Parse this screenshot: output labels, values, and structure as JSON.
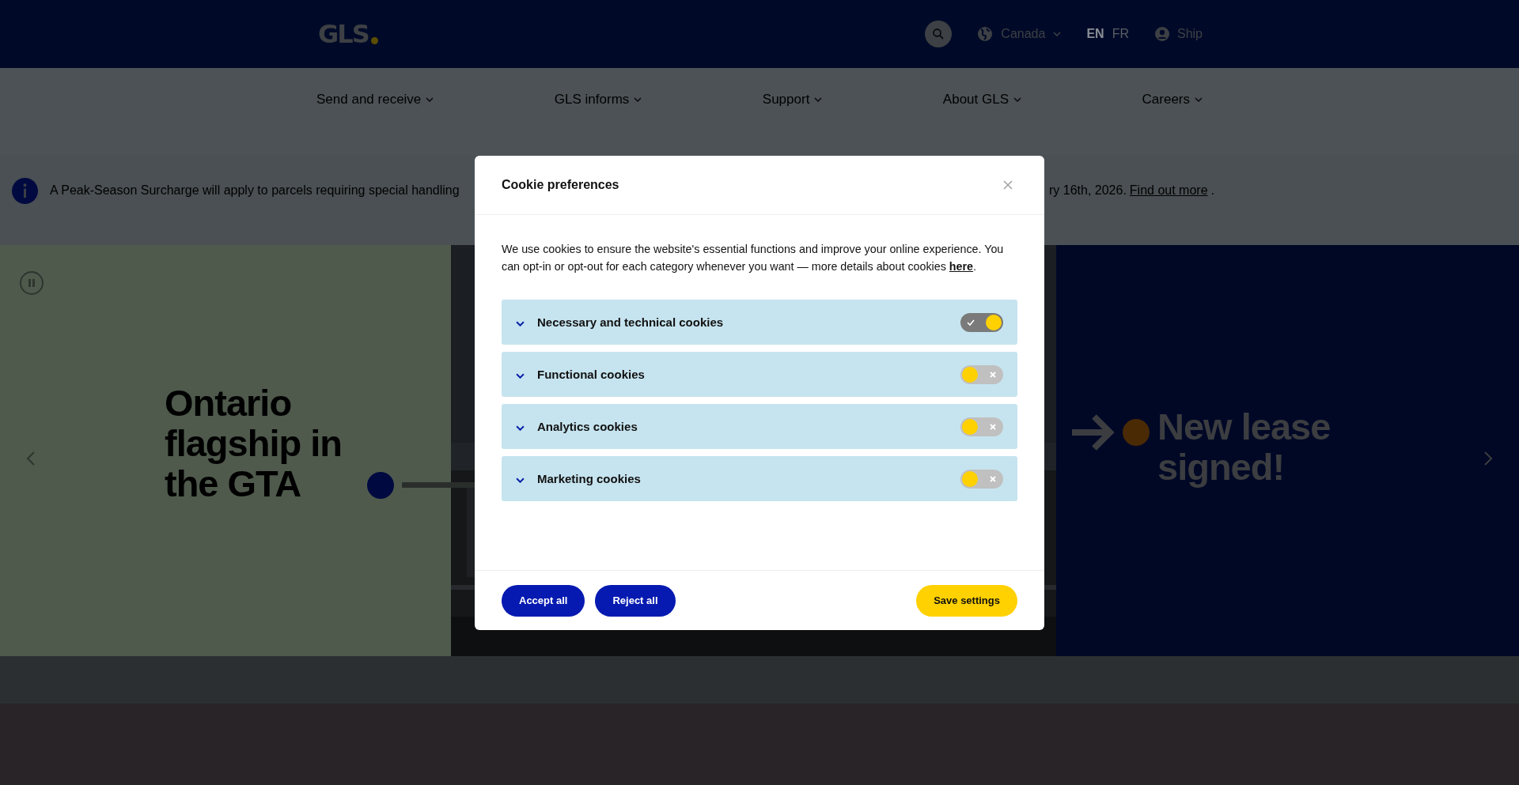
{
  "header": {
    "logo": "GLS",
    "country": "Canada",
    "account": "Ship",
    "languages": [
      {
        "label": "EN",
        "selected": true
      },
      {
        "label": "FR",
        "selected": false
      }
    ]
  },
  "nav": [
    {
      "label": "Send and receive"
    },
    {
      "label": "GLS informs"
    },
    {
      "label": "Support"
    },
    {
      "label": "About GLS"
    },
    {
      "label": "Careers"
    }
  ],
  "notice": {
    "text_start": "A Peak-Season Surcharge will apply to parcels requiring special handling",
    "text_end": "ry 16th, 2026.",
    "link": "Find out more",
    "after_link": "."
  },
  "hero": {
    "slides": [
      {
        "kind": "headline",
        "title": "Ontario flagship in the GTA"
      },
      {
        "kind": "picture"
      },
      {
        "kind": "headline-arrow",
        "title": "New lease signed!"
      }
    ]
  },
  "modal": {
    "title": "Cookie preferences",
    "intro": "We use cookies to ensure the website's essential functions and improve your online experience. You can opt-in or opt-out for each category whenever you want — more details about cookies ",
    "intro_link": "here",
    "intro_end": ".",
    "categories": [
      {
        "label": "Necessary and technical cookies",
        "checked": true
      },
      {
        "label": "Functional cookies",
        "checked": false
      },
      {
        "label": "Analytics cookies",
        "checked": false
      },
      {
        "label": "Marketing cookies",
        "checked": false
      }
    ],
    "buttons": [
      {
        "label": "Accept all",
        "kind": "primary"
      },
      {
        "label": "Reject all",
        "kind": "primary"
      },
      {
        "label": "Save settings",
        "kind": "save"
      }
    ]
  }
}
